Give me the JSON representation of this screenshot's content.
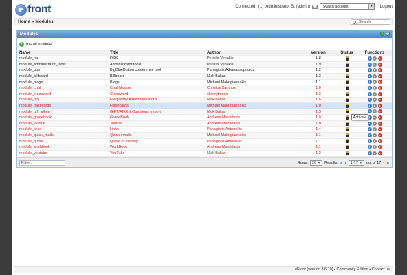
{
  "header": {
    "logo_text": "front",
    "connected_label": "Connected:",
    "connected_count": "(1)",
    "user": "Administrator S. (admin)",
    "switch_account": "[Switch account]",
    "separator": "|",
    "logout": "Logout"
  },
  "breadcrumb": {
    "home": "Home",
    "sep": "»",
    "current": "Modules"
  },
  "search": {
    "placeholder": "Search"
  },
  "panel": {
    "title": "Modules",
    "install_label": "Install module"
  },
  "table": {
    "headers": {
      "name": "Name",
      "title": "Title",
      "author": "Author",
      "version": "Version",
      "status": "Status",
      "functions": "Functions"
    },
    "rows": [
      {
        "name": "module_rss",
        "title": "RSS",
        "author": "Periklis Venakis",
        "version": "1.8"
      },
      {
        "name": "module_administrator_tools",
        "title": "Administrator tools",
        "author": "Periklis Venakis",
        "version": "1.9"
      },
      {
        "name": "module_bbb",
        "title": "BigBlueButton conference tool",
        "author": "Panagiotis Athanassopoulos",
        "version": "1.2"
      },
      {
        "name": "module_billboard",
        "title": "Billboard",
        "author": "Nick Baltas",
        "version": "1.3"
      },
      {
        "name": "module_blogs",
        "title": "Blogs",
        "author": "Michael Makrigiannakis",
        "version": "1.1"
      },
      {
        "name": "module_chat",
        "title": "Chat Module",
        "author": "Christos Xanthos",
        "version": "1.0"
      },
      {
        "name": "module_crossword",
        "title": "Crossword",
        "author": "skippybosco",
        "version": "1.3"
      },
      {
        "name": "module_faq",
        "title": "Frequently Asked Questions",
        "author": "Nick Baltas",
        "version": "1.5"
      },
      {
        "name": "module_flashcards",
        "title": "Flashcards",
        "author": "Michael Makrigiannakis",
        "version": "1.0"
      },
      {
        "name": "module_gift_aiken",
        "title": "GIFT/AIKEN Questions Import",
        "author": "Nick Baltas",
        "version": "1.3"
      },
      {
        "name": "module_gradebook",
        "title": "GradeBook",
        "author": "Andreas Makridakis",
        "version": "1.0"
      },
      {
        "name": "module_journal",
        "title": "Journal",
        "author": "Andreas Makridakis",
        "version": "1.0"
      },
      {
        "name": "module_links",
        "title": "Links",
        "author": "Panagiotis Antonellis",
        "version": "1.4"
      },
      {
        "name": "module_quick_mails",
        "title": "Quick emails",
        "author": "Michael Makrigiannakis",
        "version": "1.1"
      },
      {
        "name": "module_quote",
        "title": "Quote of the day",
        "author": "Panagiotis Antonellis",
        "version": "1.1"
      },
      {
        "name": "module_workbook",
        "title": "WorkBook",
        "author": "Andreas Makridakis",
        "version": "1.1"
      },
      {
        "name": "module_youtube",
        "title": "YouTube",
        "author": "Nick Baltas",
        "version": "1.2"
      }
    ],
    "inactive_rows": [
      5,
      6,
      7,
      8,
      9,
      10,
      11,
      12,
      13,
      14,
      15,
      16
    ],
    "highlighted_row": 8
  },
  "tooltip": "Activate",
  "pagination": {
    "filter_placeholder": "Filter...",
    "rows_label": "Rows:",
    "rows_value": "20",
    "results_label": "Results:",
    "results_value": "1-17",
    "out_of": "out of 17"
  },
  "footer": "eFront (version 3.6.10) • Community Edition • Contact us",
  "colors": {
    "inactive_text": "#d42020",
    "panel_header": "#4f87c7",
    "highlight_row": "#d3e2f6"
  }
}
